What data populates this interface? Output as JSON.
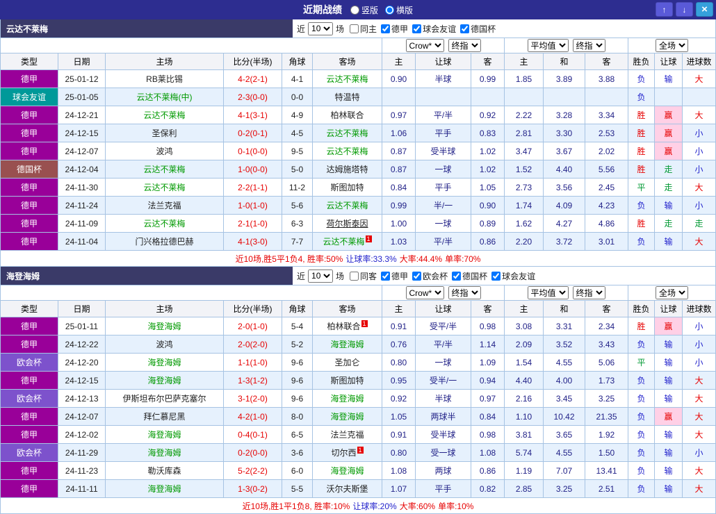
{
  "titlebar": {
    "title": "近期战绩",
    "radios": [
      {
        "label": "竖版",
        "selected": false
      },
      {
        "label": "横版",
        "selected": true
      }
    ],
    "buttons": {
      "up": "↑",
      "down": "↓",
      "close": "×"
    }
  },
  "table": {
    "columns": [
      "类型",
      "日期",
      "主场",
      "比分(半场)",
      "角球",
      "客场",
      "主",
      "让球",
      "客",
      "主",
      "和",
      "客",
      "胜负",
      "让球",
      "进球数"
    ]
  },
  "filters": {
    "company": "Crow*",
    "company_stage": "终指",
    "europe": "平均值",
    "europe_stage": "终指",
    "scope": "全场"
  },
  "colors": {
    "accent_red": "#e60000",
    "accent_blue": "#2323cc",
    "accent_green": "#009933",
    "team_green": "#009900",
    "win_bg_pink": "#ffd0e6",
    "titlebar_bg": "#2d2d90",
    "section_bg": "#3a3a68"
  },
  "type_colors": {
    "德甲": "#990099",
    "球会友谊": "#009999",
    "德国杯": "#995050",
    "欧会杯": "#7d52cc"
  },
  "sections": [
    {
      "team": "云达不莱梅",
      "near_label": "近",
      "count": "10",
      "games_label": "场",
      "checkboxes": [
        {
          "label": "同主",
          "checked": false
        },
        {
          "label": "德甲",
          "checked": true
        },
        {
          "label": "球会友谊",
          "checked": true
        },
        {
          "label": "德国杯",
          "checked": true
        }
      ],
      "rows": [
        {
          "type": "德甲",
          "date": "25-01-12",
          "home": "RB莱比锡",
          "home_focus": false,
          "score": "4-2(2-1)",
          "corner": "4-1",
          "away": "云达不莱梅",
          "away_focus": true,
          "odds": [
            "0.90",
            "半球",
            "0.99",
            "1.85",
            "3.89",
            "3.88"
          ],
          "result": "负",
          "rq": "输",
          "jq": "大"
        },
        {
          "type": "球会友谊",
          "date": "25-01-05",
          "home": "云达不莱梅(中)",
          "home_focus": true,
          "score": "2-3(0-0)",
          "corner": "0-0",
          "away": "特温特",
          "away_focus": false,
          "odds": [
            "",
            "",
            "",
            "",
            "",
            ""
          ],
          "result": "负",
          "rq": "",
          "jq": ""
        },
        {
          "type": "德甲",
          "date": "24-12-21",
          "home": "云达不莱梅",
          "home_focus": true,
          "score": "4-1(3-1)",
          "corner": "4-9",
          "away": "柏林联合",
          "away_focus": false,
          "odds": [
            "0.97",
            "平/半",
            "0.92",
            "2.22",
            "3.28",
            "3.34"
          ],
          "result": "胜",
          "rq": "赢",
          "jq": "大"
        },
        {
          "type": "德甲",
          "date": "24-12-15",
          "home": "圣保利",
          "home_focus": false,
          "score": "0-2(0-1)",
          "corner": "4-5",
          "away": "云达不莱梅",
          "away_focus": true,
          "odds": [
            "1.06",
            "平手",
            "0.83",
            "2.81",
            "3.30",
            "2.53"
          ],
          "result": "胜",
          "rq": "赢",
          "jq": "小"
        },
        {
          "type": "德甲",
          "date": "24-12-07",
          "home": "波鸿",
          "home_focus": false,
          "score": "0-1(0-0)",
          "corner": "9-5",
          "away": "云达不莱梅",
          "away_focus": true,
          "odds": [
            "0.87",
            "受半球",
            "1.02",
            "3.47",
            "3.67",
            "2.02"
          ],
          "result": "胜",
          "rq": "赢",
          "jq": "小"
        },
        {
          "type": "德国杯",
          "date": "24-12-04",
          "home": "云达不莱梅",
          "home_focus": true,
          "score": "1-0(0-0)",
          "corner": "5-0",
          "away": "达姆施塔特",
          "away_focus": false,
          "odds": [
            "0.87",
            "一球",
            "1.02",
            "1.52",
            "4.40",
            "5.56"
          ],
          "result": "胜",
          "rq": "走",
          "jq": "小"
        },
        {
          "type": "德甲",
          "date": "24-11-30",
          "home": "云达不莱梅",
          "home_focus": true,
          "score": "2-2(1-1)",
          "corner": "11-2",
          "away": "斯图加特",
          "away_focus": false,
          "odds": [
            "0.84",
            "平手",
            "1.05",
            "2.73",
            "3.56",
            "2.45"
          ],
          "result": "平",
          "rq": "走",
          "jq": "大"
        },
        {
          "type": "德甲",
          "date": "24-11-24",
          "home": "法兰克福",
          "home_focus": false,
          "score": "1-0(1-0)",
          "corner": "5-6",
          "away": "云达不莱梅",
          "away_focus": true,
          "odds": [
            "0.99",
            "半/一",
            "0.90",
            "1.74",
            "4.09",
            "4.23"
          ],
          "result": "负",
          "rq": "输",
          "jq": "小"
        },
        {
          "type": "德甲",
          "date": "24-11-09",
          "home": "云达不莱梅",
          "home_focus": true,
          "score": "2-1(1-0)",
          "corner": "6-3",
          "away": "荷尔斯泰因",
          "away_focus": false,
          "away_underline": true,
          "odds": [
            "1.00",
            "一球",
            "0.89",
            "1.62",
            "4.27",
            "4.86"
          ],
          "result": "胜",
          "rq": "走",
          "jq": "走"
        },
        {
          "type": "德甲",
          "date": "24-11-04",
          "home": "门兴格拉德巴赫",
          "home_focus": false,
          "score": "4-1(3-0)",
          "corner": "7-7",
          "away": "云达不莱梅",
          "away_focus": true,
          "away_card": "1",
          "odds": [
            "1.03",
            "平/半",
            "0.86",
            "2.20",
            "3.72",
            "3.01"
          ],
          "result": "负",
          "rq": "输",
          "jq": "大"
        }
      ],
      "summary": [
        {
          "text": "近10场,胜5平1负4, 胜率:50%",
          "color": "#e60000"
        },
        {
          "text": "让球率:33.3%",
          "color": "#2323cc"
        },
        {
          "text": "大率:44.4%",
          "color": "#e60000"
        },
        {
          "text": "单率:70%",
          "color": "#e60000"
        }
      ]
    },
    {
      "team": "海登海姆",
      "near_label": "近",
      "count": "10",
      "games_label": "场",
      "checkboxes": [
        {
          "label": "同客",
          "checked": false
        },
        {
          "label": "德甲",
          "checked": true
        },
        {
          "label": "欧会杯",
          "checked": true
        },
        {
          "label": "德国杯",
          "checked": true
        },
        {
          "label": "球会友谊",
          "checked": true
        }
      ],
      "rows": [
        {
          "type": "德甲",
          "date": "25-01-11",
          "home": "海登海姆",
          "home_focus": true,
          "score": "2-0(1-0)",
          "corner": "5-4",
          "away": "柏林联合",
          "away_focus": false,
          "away_card": "1",
          "odds": [
            "0.91",
            "受平/半",
            "0.98",
            "3.08",
            "3.31",
            "2.34"
          ],
          "result": "胜",
          "rq": "赢",
          "jq": "小"
        },
        {
          "type": "德甲",
          "date": "24-12-22",
          "home": "波鸿",
          "home_focus": false,
          "score": "2-0(2-0)",
          "corner": "5-2",
          "away": "海登海姆",
          "away_focus": true,
          "odds": [
            "0.76",
            "平/半",
            "1.14",
            "2.09",
            "3.52",
            "3.43"
          ],
          "result": "负",
          "rq": "输",
          "jq": "小"
        },
        {
          "type": "欧会杯",
          "date": "24-12-20",
          "home": "海登海姆",
          "home_focus": true,
          "score": "1-1(1-0)",
          "corner": "9-6",
          "away": "圣加仑",
          "away_focus": false,
          "odds": [
            "0.80",
            "一球",
            "1.09",
            "1.54",
            "4.55",
            "5.06"
          ],
          "result": "平",
          "rq": "输",
          "jq": "小"
        },
        {
          "type": "德甲",
          "date": "24-12-15",
          "home": "海登海姆",
          "home_focus": true,
          "score": "1-3(1-2)",
          "corner": "9-6",
          "away": "斯图加特",
          "away_focus": false,
          "odds": [
            "0.95",
            "受半/一",
            "0.94",
            "4.40",
            "4.00",
            "1.73"
          ],
          "result": "负",
          "rq": "输",
          "jq": "大"
        },
        {
          "type": "欧会杯",
          "date": "24-12-13",
          "home": "伊斯坦布尔巴萨克塞尔",
          "home_focus": false,
          "score": "3-1(2-0)",
          "corner": "9-6",
          "away": "海登海姆",
          "away_focus": true,
          "odds": [
            "0.92",
            "半球",
            "0.97",
            "2.16",
            "3.45",
            "3.25"
          ],
          "result": "负",
          "rq": "输",
          "jq": "大"
        },
        {
          "type": "德甲",
          "date": "24-12-07",
          "home": "拜仁慕尼黑",
          "home_focus": false,
          "score": "4-2(1-0)",
          "corner": "8-0",
          "away": "海登海姆",
          "away_focus": true,
          "odds": [
            "1.05",
            "两球半",
            "0.84",
            "1.10",
            "10.42",
            "21.35"
          ],
          "result": "负",
          "rq": "赢",
          "jq": "大"
        },
        {
          "type": "德甲",
          "date": "24-12-02",
          "home": "海登海姆",
          "home_focus": true,
          "score": "0-4(0-1)",
          "corner": "6-5",
          "away": "法兰克福",
          "away_focus": false,
          "odds": [
            "0.91",
            "受半球",
            "0.98",
            "3.81",
            "3.65",
            "1.92"
          ],
          "result": "负",
          "rq": "输",
          "jq": "大"
        },
        {
          "type": "欧会杯",
          "date": "24-11-29",
          "home": "海登海姆",
          "home_focus": true,
          "score": "0-2(0-0)",
          "corner": "3-6",
          "away": "切尔西",
          "away_focus": false,
          "away_card": "1",
          "odds": [
            "0.80",
            "受一球",
            "1.08",
            "5.74",
            "4.55",
            "1.50"
          ],
          "result": "负",
          "rq": "输",
          "jq": "小"
        },
        {
          "type": "德甲",
          "date": "24-11-23",
          "home": "勒沃库森",
          "home_focus": false,
          "score": "5-2(2-2)",
          "corner": "6-0",
          "away": "海登海姆",
          "away_focus": true,
          "odds": [
            "1.08",
            "两球",
            "0.86",
            "1.19",
            "7.07",
            "13.41"
          ],
          "result": "负",
          "rq": "输",
          "jq": "大"
        },
        {
          "type": "德甲",
          "date": "24-11-11",
          "home": "海登海姆",
          "home_focus": true,
          "score": "1-3(0-2)",
          "corner": "5-5",
          "away": "沃尔夫斯堡",
          "away_focus": false,
          "odds": [
            "1.07",
            "平手",
            "0.82",
            "2.85",
            "3.25",
            "2.51"
          ],
          "result": "负",
          "rq": "输",
          "jq": "大"
        }
      ],
      "summary": [
        {
          "text": "近10场,胜1平1负8, 胜率:10%",
          "color": "#e60000"
        },
        {
          "text": "让球率:20%",
          "color": "#2323cc"
        },
        {
          "text": "大率:60%",
          "color": "#e60000"
        },
        {
          "text": "单率:10%",
          "color": "#e60000"
        }
      ]
    }
  ]
}
